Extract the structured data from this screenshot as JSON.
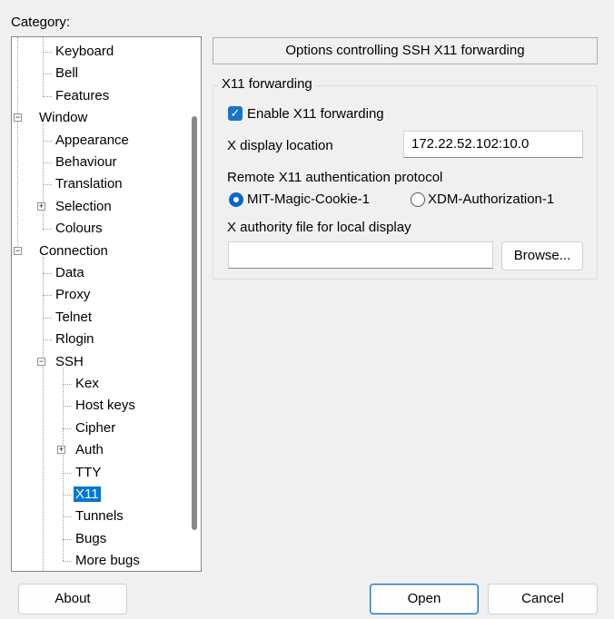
{
  "category_label": "Category:",
  "tree": [
    {
      "label": "Keyboard"
    },
    {
      "label": "Bell"
    },
    {
      "label": "Features"
    },
    {
      "label": "Window",
      "expander": "−"
    },
    {
      "label": "Appearance"
    },
    {
      "label": "Behaviour"
    },
    {
      "label": "Translation"
    },
    {
      "label": "Selection",
      "expander": "+"
    },
    {
      "label": "Colours"
    },
    {
      "label": "Connection",
      "expander": "−"
    },
    {
      "label": "Data"
    },
    {
      "label": "Proxy"
    },
    {
      "label": "Telnet"
    },
    {
      "label": "Rlogin"
    },
    {
      "label": "SSH",
      "expander": "−"
    },
    {
      "label": "Kex"
    },
    {
      "label": "Host keys"
    },
    {
      "label": "Cipher"
    },
    {
      "label": "Auth",
      "expander": "+"
    },
    {
      "label": "TTY"
    },
    {
      "label": "X11",
      "selected": true
    },
    {
      "label": "Tunnels"
    },
    {
      "label": "Bugs"
    },
    {
      "label": "More bugs"
    }
  ],
  "panel": {
    "header": "Options controlling SSH X11 forwarding",
    "group_title": "X11 forwarding",
    "enable_label": "Enable X11 forwarding",
    "enable_checked": true,
    "display_location_label": "X display location",
    "display_location_value": "172.22.52.102:10.0",
    "auth_protocol_label": "Remote X11 authentication protocol",
    "radio_mit": "MIT-Magic-Cookie-1",
    "radio_xdm": "XDM-Authorization-1",
    "selected_protocol": "MIT-Magic-Cookie-1",
    "authority_file_label": "X authority file for local display",
    "authority_file_value": "",
    "browse_label": "Browse..."
  },
  "buttons": {
    "about": "About",
    "open": "Open",
    "cancel": "Cancel"
  }
}
